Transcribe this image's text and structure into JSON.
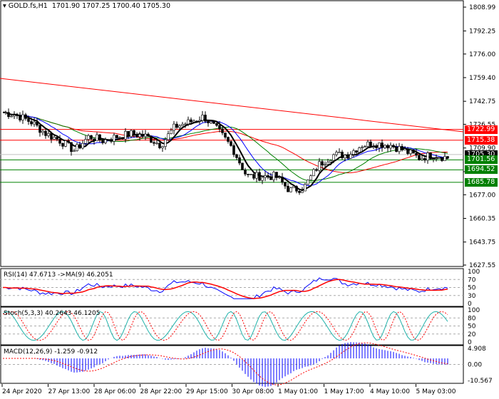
{
  "header": {
    "symbol": "GOLD.fs,H1",
    "ohlc": "1701.90 1707.25 1700.40 1705.30"
  },
  "price_labels": [
    {
      "text": "1722.99",
      "value": 1722.99,
      "color": "#ff0000"
    },
    {
      "text": "1715.38",
      "value": 1715.38,
      "color": "#ff0000"
    },
    {
      "text": "1705.30",
      "value": 1705.3,
      "color": "#000000"
    },
    {
      "text": "1701.56",
      "value": 1701.56,
      "color": "#008000"
    },
    {
      "text": "1694.52",
      "value": 1694.52,
      "color": "#008000"
    },
    {
      "text": "1685.78",
      "value": 1685.78,
      "color": "#008000"
    }
  ],
  "indicators": {
    "rsi": "RSI(14) 47.6713  ->MA(9) 46.2051",
    "stoch": "Stoch(5,3,3) 40.2643 46.1205",
    "macd": "MACD(12,26,9) -1.259 -0.912"
  },
  "chart_data": {
    "type": "candlestick",
    "title": "GOLD.fs,H1",
    "ylim": [
      1627.55,
      1808.99
    ],
    "yticks": [
      "1808.99",
      "1792.25",
      "1776.00",
      "1759.40",
      "1742.75",
      "1726.55",
      "1709.90",
      "1693.25",
      "1677.00",
      "1660.35",
      "1643.75",
      "1627.55"
    ],
    "xticks": [
      "24 Apr 2020",
      "27 Apr 13:00",
      "28 Apr 06:00",
      "28 Apr 22:00",
      "29 Apr 15:00",
      "30 Apr 08:00",
      "1 May 01:00",
      "1 May 17:00",
      "4 May 10:00",
      "5 May 03:00"
    ],
    "close_path": [
      1735,
      1733,
      1728,
      1720,
      1715,
      1708,
      1718,
      1715,
      1718,
      1720,
      1718,
      1712,
      1725,
      1728,
      1732,
      1722,
      1710,
      1690,
      1690,
      1690,
      1680,
      1682,
      1698,
      1705,
      1705,
      1712,
      1713,
      1712,
      1708,
      1703,
      1705,
      1703
    ],
    "trendline": [
      1758.9,
      1721.3
    ],
    "levels": [
      1722.99,
      1715.38,
      1701.56,
      1694.52,
      1685.78
    ],
    "rsi": {
      "ticks": [
        "100",
        "70",
        "50",
        "30",
        "0"
      ]
    },
    "stoch": {
      "ticks": [
        "100",
        "80",
        "50",
        "20",
        "0"
      ]
    },
    "macd": {
      "ticks": [
        "4.908",
        "0.00",
        "-10.567"
      ]
    }
  },
  "colors": {
    "up": "#000000",
    "down": "#000000",
    "ma_red": "#ff0000",
    "ma_green": "#008000",
    "ma_blue": "#0000ff",
    "stoch": "#20b2aa"
  }
}
